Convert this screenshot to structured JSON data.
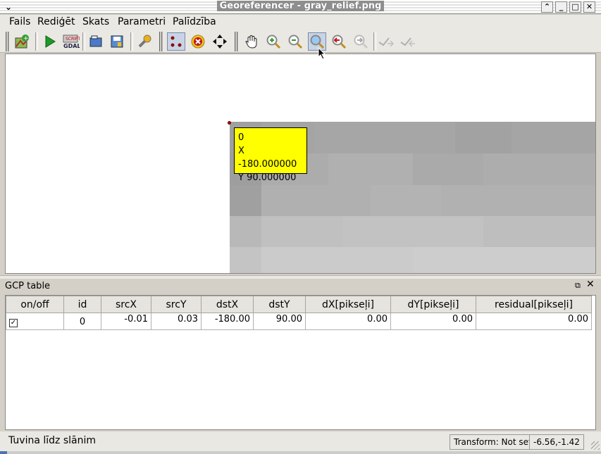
{
  "window": {
    "title": "Georeferencer - gray_relief.png"
  },
  "menu": [
    "Fails",
    "Rediģēt",
    "Skats",
    "Parametri",
    "Palīdzība"
  ],
  "toolbar": {
    "icons": [
      "open-raster-icon",
      "start-georef-icon",
      "gdal-script-icon",
      "load-gcp-icon",
      "save-gcp-icon",
      "settings-icon",
      "add-point-icon",
      "delete-point-icon",
      "move-point-icon",
      "pan-icon",
      "zoom-in-icon",
      "zoom-out-icon",
      "zoom-to-layer-icon",
      "zoom-last-icon",
      "zoom-next-icon",
      "link-georef-icon",
      "link-qgis-icon"
    ]
  },
  "canvas": {
    "gcp_label": {
      "id": "0",
      "x": "X -180.000000",
      "y": "Y 90.000000"
    }
  },
  "gcp_panel": {
    "title": "GCP table",
    "columns": [
      "on/off",
      "id",
      "srcX",
      "srcY",
      "dstX",
      "dstY",
      "dX[pikseļi]",
      "dY[pikseļi]",
      "residual[pikseļi]"
    ],
    "rows": [
      {
        "enabled": true,
        "id": "0",
        "srcX": "-0.01",
        "srcY": "0.03",
        "dstX": "-180.00",
        "dstY": "90.00",
        "dX": "0.00",
        "dY": "0.00",
        "residual": "0.00"
      }
    ]
  },
  "status": {
    "message": "Tuvina līdz slānim",
    "transform": "Transform: Not set",
    "coords": "-6.56,-1.42"
  }
}
